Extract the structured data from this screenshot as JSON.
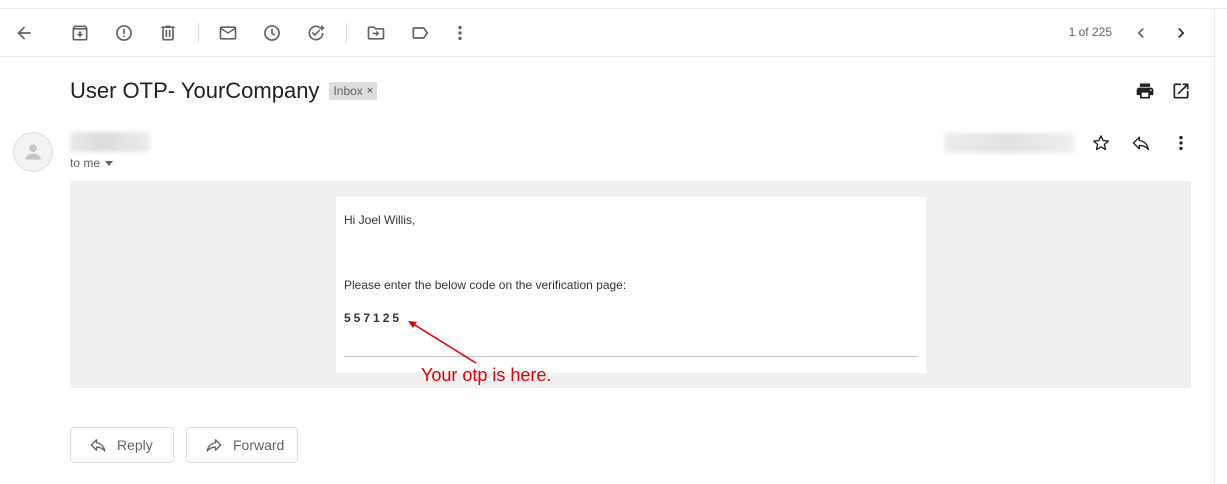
{
  "toolbar": {
    "pager_text": "1 of 225"
  },
  "message": {
    "subject": "User OTP- YourCompany",
    "label": "Inbox",
    "label_close": "×",
    "recipient": "to me"
  },
  "email_body": {
    "greeting": "Hi Joel Willis,",
    "instruction": "Please enter the below code on the verification page:",
    "otp_code": "557125"
  },
  "annotation": {
    "text": "Your otp is here.",
    "color": "#e00000"
  },
  "actions": {
    "reply_label": "Reply",
    "forward_label": "Forward"
  },
  "icons": {
    "toolbar": [
      "back-arrow-icon",
      "archive-icon",
      "report-spam-icon",
      "delete-icon",
      "mark-unread-icon",
      "snooze-icon",
      "add-task-icon",
      "move-to-icon",
      "labels-icon",
      "more-vert-icon",
      "chevron-left-icon",
      "chevron-right-icon"
    ],
    "header": [
      "print-icon",
      "open-new-window-icon",
      "star-icon",
      "reply-icon",
      "more-vert-icon"
    ]
  },
  "colors": {
    "text_primary": "#202124",
    "text_secondary": "#5f6368",
    "email_background": "#f0f0f0",
    "label_chip": "#dddddd"
  }
}
